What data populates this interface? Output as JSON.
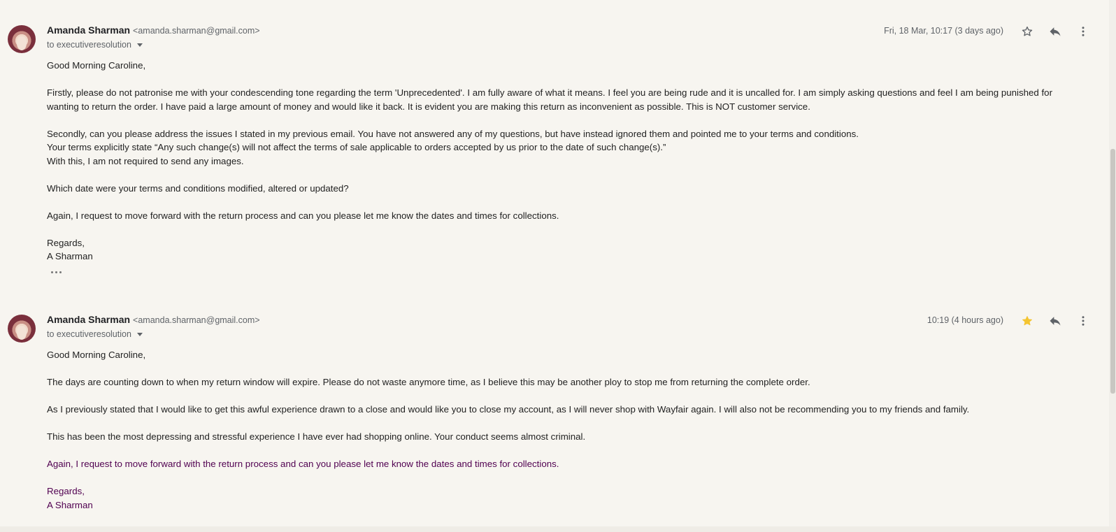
{
  "messages": [
    {
      "sender_name": "Amanda Sharman",
      "sender_email": "<amanda.sharman@gmail.com>",
      "to": "to executiveresolution",
      "date": "Fri, 18 Mar, 10:17 (3 days ago)",
      "starred": false,
      "body": {
        "greeting": "Good Morning Caroline,",
        "p1": "Firstly, please do not patronise me with your condescending tone regarding the term 'Unprecedented'. I am fully aware of what it means. I feel you are being rude and it is uncalled for.  I am simply asking questions and feel I am being punished for wanting to return the order. I have paid a large amount of money and would like it back.  It is evident you are making this return as inconvenient as possible. This is NOT customer service.",
        "p2a": "Secondly, can you please address the issues I stated in my previous email. You have not answered any of my questions, but have instead ignored them and pointed me to your terms and conditions.",
        "p2b": "Your terms explicitly state “Any such change(s) will not affect the terms of sale applicable to orders accepted by us prior to the date of such change(s).”",
        "p2c": "With this, I am not required to send any images.",
        "p3": "Which date were your terms and conditions modified, altered or updated?",
        "p4": "Again, I request to move forward with the return process and can you please let me know the dates and times for collections.",
        "signoff": "Regards,",
        "signature": "A Sharman"
      }
    },
    {
      "sender_name": "Amanda Sharman",
      "sender_email": "<amanda.sharman@gmail.com>",
      "to": "to executiveresolution",
      "date": "10:19 (4 hours ago)",
      "starred": true,
      "body": {
        "greeting": "Good Morning Caroline,",
        "p1": "The days are counting down to when my return window will expire. Please do not waste anymore time, as I believe this may be another ploy to stop me from returning the complete order.",
        "p2": "As I previously stated that I would like to get this awful experience drawn to a close and would like you to close my account, as I will never shop with Wayfair again. I will also not be recommending you to my friends and family.",
        "p3": "This has been the most depressing and stressful experience I have ever had shopping online. Your conduct seems almost criminal.",
        "p4": "Again, I request to move forward with the return process and can you please let me know the dates and times for collections.",
        "signoff": "Regards,",
        "signature": "A Sharman"
      }
    }
  ],
  "icons": {
    "star": "star-icon",
    "reply": "reply-icon",
    "more": "more-vert-icon",
    "expand": "dropdown-caret-icon",
    "trimmed": "show-trimmed-content-icon"
  },
  "colors": {
    "background": "#f7f5f0",
    "star_active": "#f4c430",
    "quoted_text": "#500050"
  }
}
